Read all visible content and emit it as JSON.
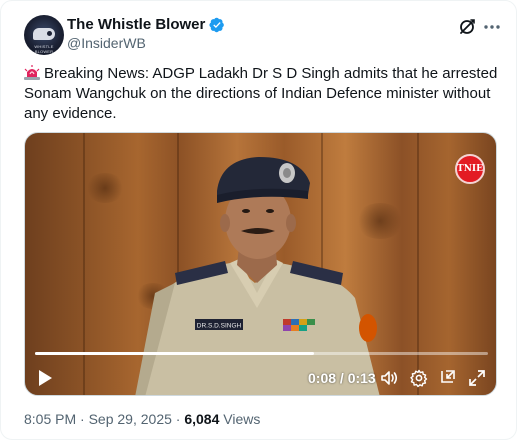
{
  "author": {
    "name": "The Whistle Blower",
    "handle": "@InsiderWB",
    "verified": true,
    "avatar_caption": "WHISTLE BLOWER"
  },
  "tweet": {
    "text": "Breaking News: ADGP Ladakh Dr S D Singh admits that he arrested Sonam Wangchuk on the directions of Indian Defence minister without any evidence.",
    "leading_icon": "siren-emoji-icon"
  },
  "video": {
    "channel_badge": "TNIE",
    "nameplate": "DR.S.D.SINGH",
    "current_time": "0:08",
    "duration": "0:13",
    "time_display": "0:08 / 0:13",
    "progress_fraction": 0.6154
  },
  "meta": {
    "time": "8:05 PM",
    "date": "Sep 29, 2025",
    "separator": "·",
    "views_count": "6,084",
    "views_label": "Views"
  },
  "colors": {
    "text_primary": "#0f1419",
    "text_secondary": "#536471",
    "verified_blue": "#1d9bf0",
    "badge_red": "#e31b23"
  },
  "icons": [
    "grok-icon",
    "more-icon",
    "verified-icon",
    "play-icon",
    "volume-icon",
    "settings-gear-icon",
    "exit-fullscreen-icon",
    "fullscreen-icon"
  ]
}
